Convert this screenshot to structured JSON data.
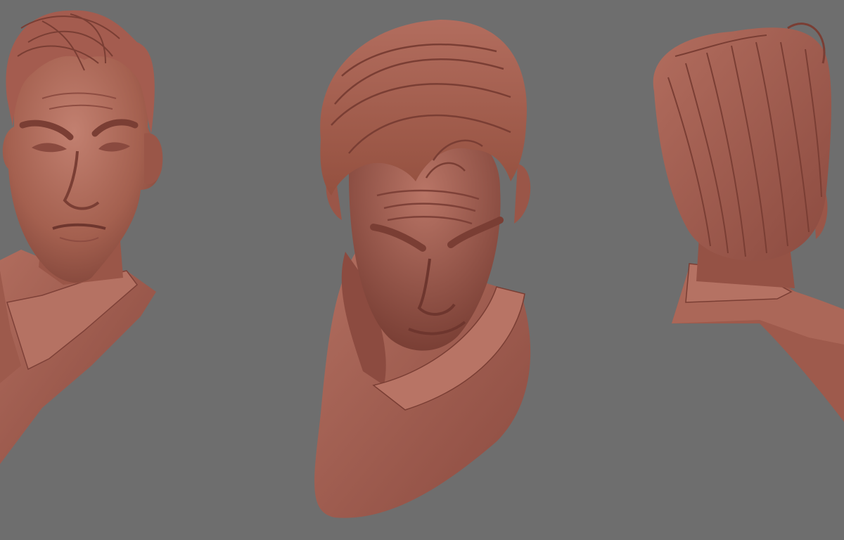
{
  "scene": {
    "background_color": "#6e6e6e",
    "clay_color": "#a65f52",
    "clay_shadow": "#7e4138",
    "clay_highlight": "#c07a6c",
    "views": [
      {
        "name": "front-three-quarter",
        "icon": "sculpt-bust-front"
      },
      {
        "name": "top-down",
        "icon": "sculpt-bust-top"
      },
      {
        "name": "back-three-quarter",
        "icon": "sculpt-bust-back"
      }
    ]
  }
}
